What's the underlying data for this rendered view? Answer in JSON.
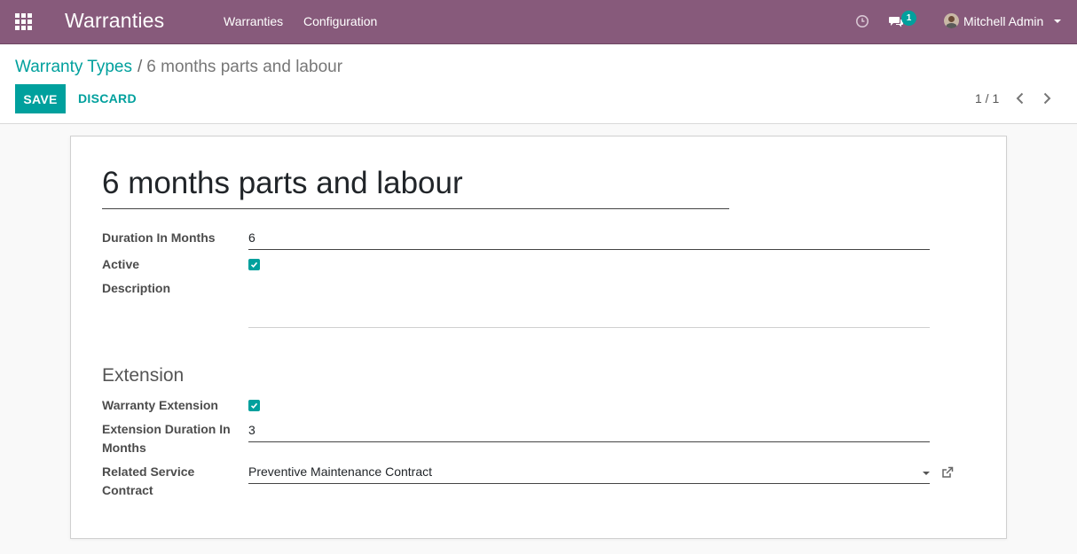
{
  "navbar": {
    "app_title": "Warranties",
    "menu": [
      "Warranties",
      "Configuration"
    ],
    "chat_badge": "1",
    "user_name": "Mitchell Admin",
    "brand_color": "#875a7b",
    "accent_color": "#00a09d"
  },
  "breadcrumb": {
    "parent": "Warranty Types",
    "separator": "/",
    "current": "6 months parts and labour"
  },
  "toolbar": {
    "save_label": "SAVE",
    "discard_label": "DISCARD"
  },
  "pager": {
    "value": "1 / 1"
  },
  "form": {
    "name": "6 months parts and labour",
    "duration_label": "Duration In Months",
    "duration_value": "6",
    "active_label": "Active",
    "active_checked": true,
    "description_label": "Description",
    "description_value": "",
    "extension_section_title": "Extension",
    "warranty_extension_label": "Warranty Extension",
    "warranty_extension_checked": true,
    "extension_duration_label": "Extension Duration In Months",
    "extension_duration_value": "3",
    "related_contract_label": "Related Service Contract",
    "related_contract_value": "Preventive Maintenance Contract"
  },
  "icons": {
    "apps": "grid-icon",
    "activity": "clock-icon",
    "messages": "chat-bubbles-icon",
    "pager_prev": "chevron-left-icon",
    "pager_next": "chevron-right-icon",
    "external": "external-link-icon"
  }
}
